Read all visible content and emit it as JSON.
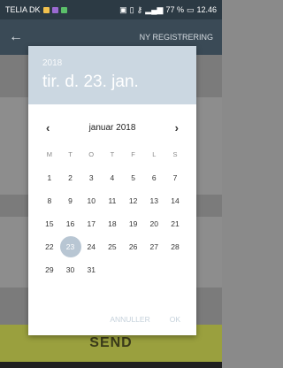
{
  "status": {
    "carrier": "TELIA DK",
    "battery": "77 %",
    "time": "12.46"
  },
  "appbar": {
    "title": "NY REGISTRERING"
  },
  "send_label": "SEND",
  "dialog": {
    "year": "2018",
    "selected_date": "tir. d. 23. jan.",
    "month_label": "januar 2018",
    "weekdays": [
      "M",
      "T",
      "O",
      "T",
      "F",
      "L",
      "S"
    ],
    "weeks": [
      [
        "",
        "1",
        "2",
        "3",
        "4",
        "5",
        "6",
        "7"
      ],
      [
        "8",
        "9",
        "10",
        "11",
        "12",
        "13",
        "14"
      ],
      [
        "15",
        "16",
        "17",
        "18",
        "19",
        "20",
        "21"
      ],
      [
        "22",
        "23",
        "24",
        "25",
        "26",
        "27",
        "28"
      ],
      [
        "29",
        "30",
        "31",
        "",
        "",
        "",
        ""
      ]
    ],
    "selected_day": "23",
    "cancel_label": "ANNULLER",
    "ok_label": "OK"
  },
  "colors": {
    "header": "#cbd7e1",
    "selected": "#b8c6d3",
    "accent_bar": "#9aa03e"
  }
}
